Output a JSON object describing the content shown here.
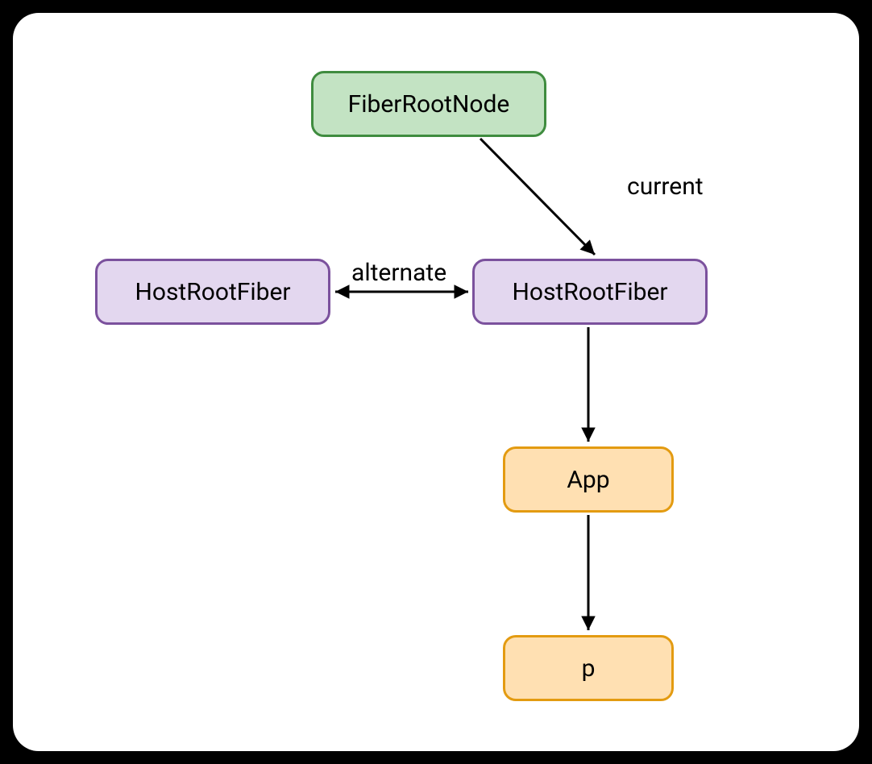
{
  "nodes": {
    "fiberRootNode": {
      "label": "FiberRootNode"
    },
    "hostRootFiberL": {
      "label": "HostRootFiber"
    },
    "hostRootFiberR": {
      "label": "HostRootFiber"
    },
    "app": {
      "label": "App"
    },
    "p": {
      "label": "p"
    }
  },
  "edges": {
    "current": {
      "label": "current"
    },
    "alternate": {
      "label": "alternate"
    }
  },
  "colors": {
    "greenFill": "#c3e3c3",
    "greenBorder": "#3f8c3f",
    "purpleFill": "#e3d7ef",
    "purpleBorder": "#7b519d",
    "orangeFill": "#ffe0b2",
    "orangeBorder": "#e39b11",
    "arrow": "#000000"
  }
}
